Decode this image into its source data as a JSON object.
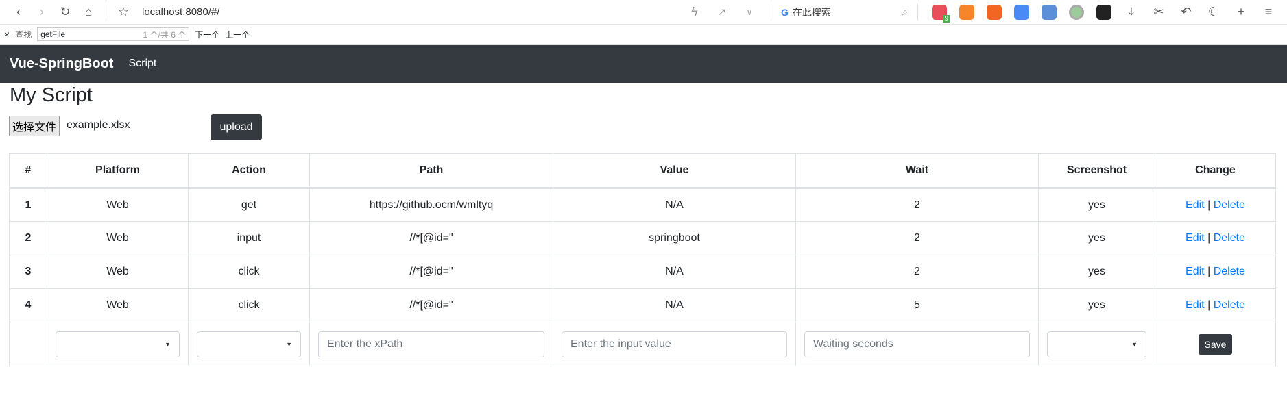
{
  "browser": {
    "url": "localhost:8080/#/",
    "search_placeholder": "在此搜索",
    "ext_badge": "9"
  },
  "find": {
    "close": "×",
    "label": "查找",
    "query": "getFile",
    "count": "1 个/共 6 个",
    "next": "下一个",
    "prev": "上一个"
  },
  "navbar": {
    "brand": "Vue-SpringBoot",
    "link": "Script"
  },
  "page": {
    "title": "My Script",
    "choose_file": "选择文件",
    "file_name": "example.xlsx",
    "upload": "upload"
  },
  "table": {
    "headers": [
      "#",
      "Platform",
      "Action",
      "Path",
      "Value",
      "Wait",
      "Screenshot",
      "Change"
    ],
    "rows": [
      {
        "id": "1",
        "platform": "Web",
        "action": "get",
        "path": "https://github.ocm/wmltyq",
        "value": "N/A",
        "wait": "2",
        "screenshot": "yes"
      },
      {
        "id": "2",
        "platform": "Web",
        "action": "input",
        "path": "//*[@id=\"",
        "value": "springboot",
        "wait": "2",
        "screenshot": "yes"
      },
      {
        "id": "3",
        "platform": "Web",
        "action": "click",
        "path": "//*[@id=\"",
        "value": "N/A",
        "wait": "2",
        "screenshot": "yes"
      },
      {
        "id": "4",
        "platform": "Web",
        "action": "click",
        "path": "//*[@id=\"",
        "value": "N/A",
        "wait": "5",
        "screenshot": "yes"
      }
    ],
    "edit": "Edit",
    "sep": "|",
    "delete": "Delete",
    "form": {
      "path_placeholder": "Enter the xPath",
      "value_placeholder": "Enter the input value",
      "wait_placeholder": "Waiting seconds",
      "save": "Save"
    }
  }
}
